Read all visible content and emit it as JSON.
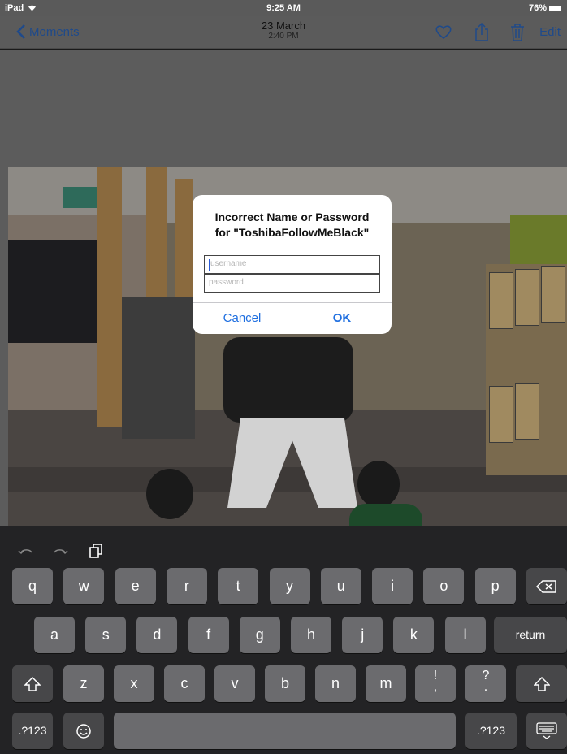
{
  "status": {
    "device": "iPad",
    "wifi_icon": "wifi-icon",
    "time": "9:25 AM",
    "battery": "76%",
    "battery_icon": "battery-icon"
  },
  "nav": {
    "back_label": "Moments",
    "title_date": "23 March",
    "title_time": "2:40 PM",
    "icons": [
      "heart-icon",
      "share-icon",
      "trash-icon"
    ],
    "edit_label": "Edit",
    "accent": "#1f4a8a"
  },
  "alert": {
    "title_line1": "Incorrect Name or Password",
    "title_line2": "for \"ToshibaFollowMeBlack\"",
    "username_placeholder": "username",
    "password_placeholder": "password",
    "cancel_label": "Cancel",
    "ok_label": "OK",
    "button_color": "#1f6fe0"
  },
  "keyboard": {
    "shortcuts": [
      "undo-icon",
      "redo-icon",
      "paste-icon"
    ],
    "row1": [
      "q",
      "w",
      "e",
      "r",
      "t",
      "y",
      "u",
      "i",
      "o",
      "p"
    ],
    "row2": [
      "a",
      "s",
      "d",
      "f",
      "g",
      "h",
      "j",
      "k",
      "l"
    ],
    "row3": [
      "z",
      "x",
      "c",
      "v",
      "b",
      "n",
      "m"
    ],
    "row3_punct": [
      {
        "top": "!",
        "bottom": ","
      },
      {
        "top": "?",
        "bottom": "."
      }
    ],
    "return_label": "return",
    "numbers_label": ".?123",
    "space_label": ""
  }
}
